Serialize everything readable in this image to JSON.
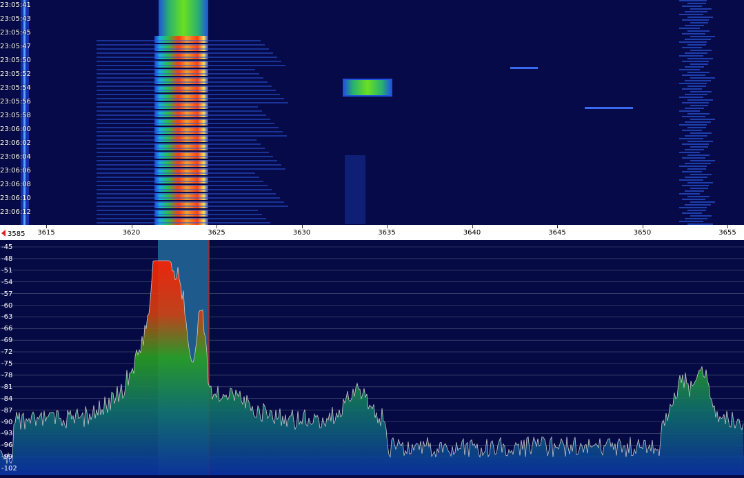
{
  "waterfall": {
    "timestamps": [
      "23:05:41",
      "23:05:43",
      "23:05:45",
      "23:05:47",
      "23:05:50",
      "23:05:52",
      "23:05:54",
      "23:05:56",
      "23:05:58",
      "23:06:00",
      "23:06:02",
      "23:06:04",
      "23:06:06",
      "23:06:08",
      "23:06:10",
      "23:06:12"
    ]
  },
  "frequency_scale": {
    "start_label": "3585",
    "labels": [
      "3615",
      "3620",
      "3625",
      "3630",
      "3635",
      "3640",
      "3645",
      "3650",
      "3655"
    ]
  },
  "spectrum": {
    "db_labels": [
      "-45",
      "-48",
      "-51",
      "-54",
      "-57",
      "-60",
      "-63",
      "-66",
      "-69",
      "-72",
      "-75",
      "-78",
      "-81",
      "-84",
      "-87",
      "-90",
      "-93",
      "-96",
      "-99",
      "-102"
    ]
  },
  "colors": {
    "background": "#060a44",
    "waterfall_hot": "#ff3010",
    "spectrum_trace": "#c8c8c8",
    "passband": "#1e5a8c",
    "passband_edge": "#c02020"
  }
}
